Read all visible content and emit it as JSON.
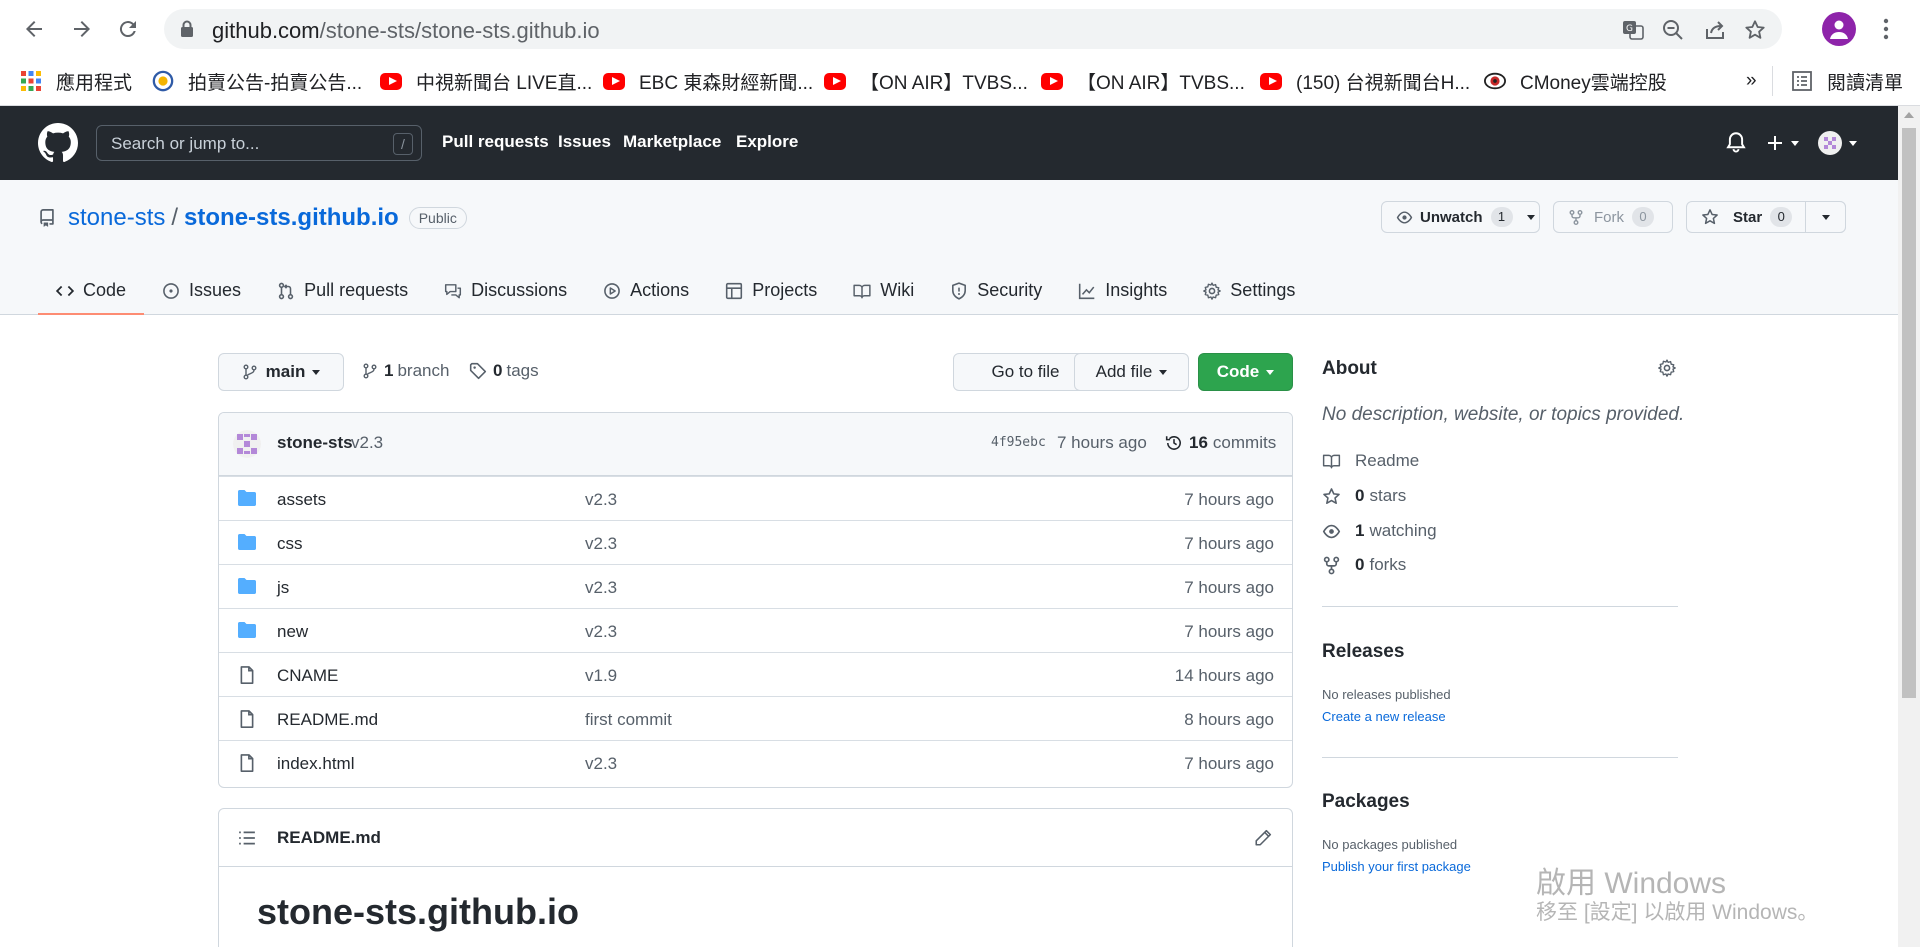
{
  "browser": {
    "url_host": "github.com",
    "url_path": "/stone-sts/stone-sts.github.io",
    "bookmarks": [
      {
        "label": "應用程式",
        "icon": "apps-grid-icon"
      },
      {
        "label": "拍賣公告-拍賣公告...",
        "icon": "auction-site-icon"
      },
      {
        "label": "中視新聞台 LIVE直...",
        "icon": "youtube-icon"
      },
      {
        "label": "EBC 東森財經新聞...",
        "icon": "youtube-icon"
      },
      {
        "label": "【ON AIR】TVBS...",
        "icon": "youtube-icon"
      },
      {
        "label": "【ON AIR】TVBS...",
        "icon": "youtube-icon"
      },
      {
        "label": "(150) 台視新聞台H...",
        "icon": "youtube-icon"
      },
      {
        "label": "CMoney雲端控股",
        "icon": "cmoney-icon"
      }
    ],
    "more": "»",
    "reading_list": "閱讀清單"
  },
  "gh": {
    "search_placeholder": "Search or jump to...",
    "search_key": "/",
    "nav": [
      "Pull requests",
      "Issues",
      "Marketplace",
      "Explore"
    ]
  },
  "repo": {
    "owner": "stone-sts",
    "sep": "/",
    "name": "stone-sts.github.io",
    "visibility": "Public",
    "unwatch_label": "Unwatch",
    "unwatch_count": "1",
    "fork_label": "Fork",
    "fork_count": "0",
    "star_label": "Star",
    "star_count": "0",
    "tabs": [
      "Code",
      "Issues",
      "Pull requests",
      "Discussions",
      "Actions",
      "Projects",
      "Wiki",
      "Security",
      "Insights",
      "Settings"
    ]
  },
  "main": {
    "branch": "main",
    "branch_count": "1",
    "branch_word": "branch",
    "tag_count": "0",
    "tag_word": "tags",
    "goto_file": "Go to file",
    "add_file": "Add file",
    "code": "Code"
  },
  "commit": {
    "author": "stone-sts",
    "message": "v2.3",
    "sha": "4f95ebc",
    "when": "7 hours ago",
    "count": "16",
    "count_word": "commits"
  },
  "files": [
    {
      "name": "assets",
      "type": "folder",
      "message": "v2.3",
      "age": "7 hours ago"
    },
    {
      "name": "css",
      "type": "folder",
      "message": "v2.3",
      "age": "7 hours ago"
    },
    {
      "name": "js",
      "type": "folder",
      "message": "v2.3",
      "age": "7 hours ago"
    },
    {
      "name": "new",
      "type": "folder",
      "message": "v2.3",
      "age": "7 hours ago"
    },
    {
      "name": "CNAME",
      "type": "file",
      "message": "v1.9",
      "age": "14 hours ago"
    },
    {
      "name": "README.md",
      "type": "file",
      "message": "first commit",
      "age": "8 hours ago"
    },
    {
      "name": "index.html",
      "type": "file",
      "message": "v2.3",
      "age": "7 hours ago"
    }
  ],
  "readme": {
    "filename": "README.md",
    "heading": "stone-sts.github.io"
  },
  "about": {
    "title": "About",
    "description": "No description, website, or topics provided.",
    "readme": "Readme",
    "stars_count": "0",
    "stars_word": "stars",
    "watching_count": "1",
    "watching_word": "watching",
    "forks_count": "0",
    "forks_word": "forks"
  },
  "releases": {
    "title": "Releases",
    "none": "No releases published",
    "create": "Create a new release"
  },
  "packages": {
    "title": "Packages",
    "none": "No packages published",
    "publish": "Publish your first package"
  },
  "watermark": {
    "line1": "啟用 Windows",
    "line2": "移至 [設定] 以啟用 Windows。"
  },
  "colors": {
    "header_bg": "#24292f",
    "link": "#0969da",
    "green_button": "#2da44e",
    "folder": "#54aeff",
    "active_tab_underline": "#fd8c73"
  }
}
